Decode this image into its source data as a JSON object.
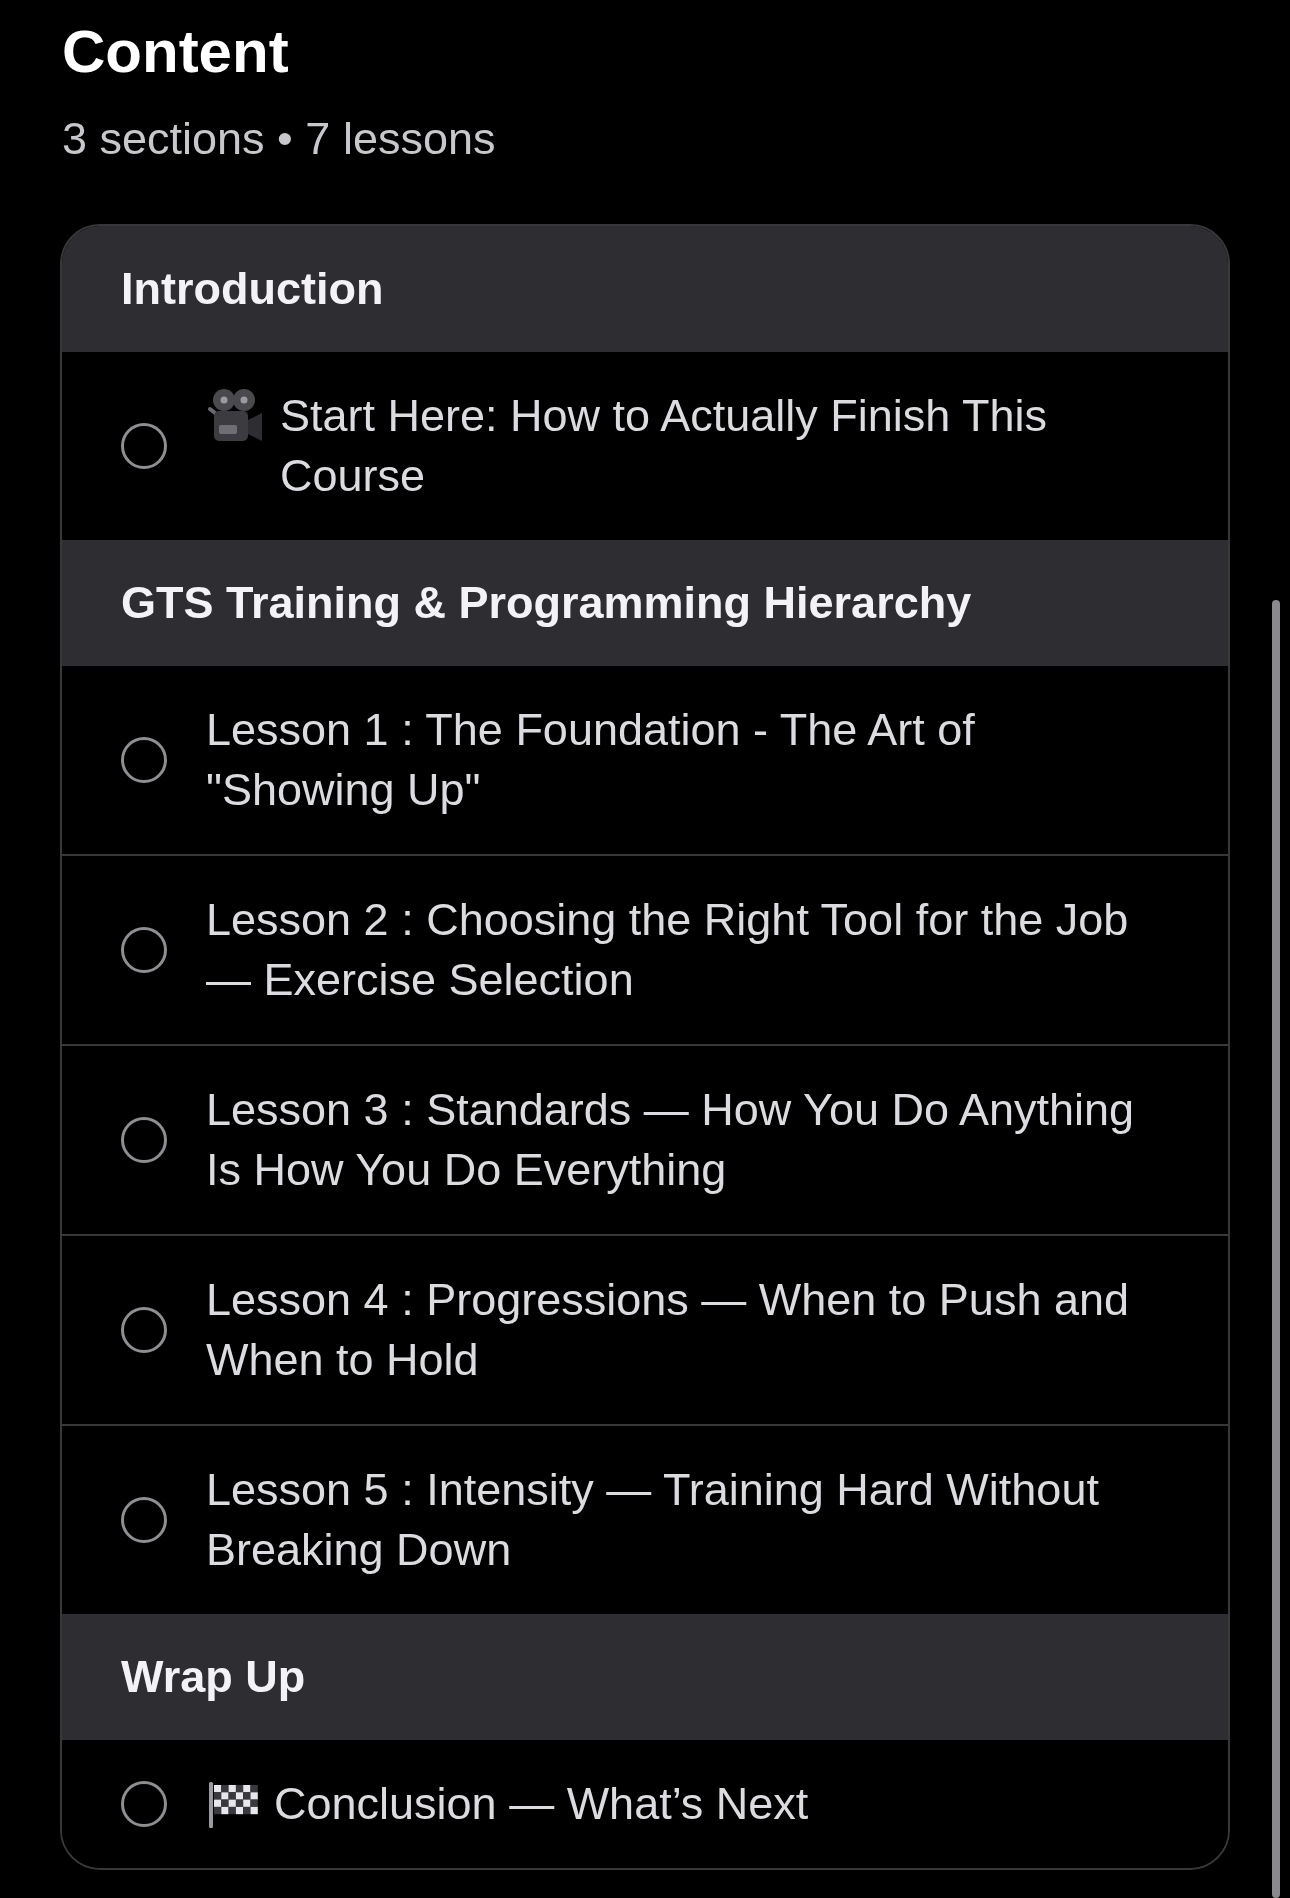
{
  "page": {
    "title": "Content",
    "summary": "3 sections • 7 lessons"
  },
  "sections": [
    {
      "title": "Introduction",
      "lessons": [
        {
          "title": "Start Here: How to Actually Finish This Course",
          "kind": "video",
          "completed": false
        }
      ]
    },
    {
      "title": "GTS Training & Programming Hierarchy",
      "lessons": [
        {
          "title": "Lesson 1 : The Foundation - The Art of \"Showing Up\"",
          "kind": "lesson",
          "completed": false
        },
        {
          "title": "Lesson 2 : Choosing the Right Tool for the Job — Exercise Selection",
          "kind": "lesson",
          "completed": false
        },
        {
          "title": "Lesson 3 : Standards — How You Do Anything Is How You Do Everything",
          "kind": "lesson",
          "completed": false
        },
        {
          "title": "Lesson 4 : Progressions — When to Push and When to Hold",
          "kind": "lesson",
          "completed": false
        },
        {
          "title": "Lesson 5 : Intensity — Training Hard Without Breaking Down",
          "kind": "lesson",
          "completed": false
        }
      ]
    },
    {
      "title": "Wrap Up",
      "lessons": [
        {
          "title": "Conclusion — What’s Next",
          "kind": "finish",
          "completed": false
        }
      ]
    }
  ]
}
